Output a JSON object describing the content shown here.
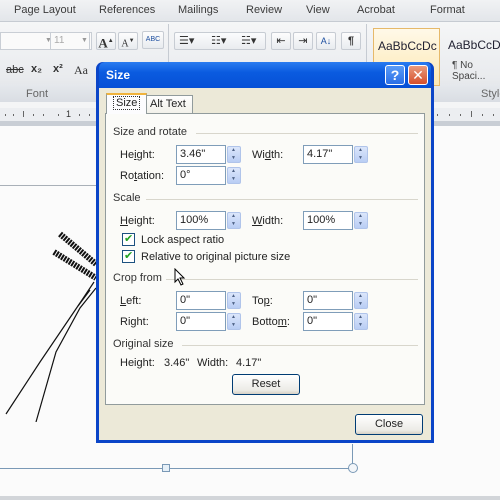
{
  "ribbon": {
    "tabs": [
      "Page Layout",
      "References",
      "Mailings",
      "Review",
      "View",
      "Acrobat",
      "Format"
    ],
    "font_size_value": "11",
    "group_labels": {
      "font": "Font",
      "styles": "Style"
    },
    "buttons": {
      "grow_font": "A",
      "shrink_font": "A",
      "clear_format": "ABC",
      "strikethrough": "abc",
      "subscript": "x₂",
      "superscript": "x²",
      "change_case": "Aa",
      "sort": "A↓",
      "show_marks": "¶"
    },
    "styles": [
      {
        "preview": "AaBbCcDc",
        "name": "",
        "selected": true
      },
      {
        "preview": "AaBbCcDc",
        "name": "¶ No Spaci...",
        "selected": false
      }
    ]
  },
  "ruler": {
    "label": "1"
  },
  "dialog": {
    "title": "Size",
    "help_glyph": "?",
    "close_glyph": "✕",
    "tabs": [
      {
        "label": "Size",
        "active": true
      },
      {
        "label": "Alt Text",
        "active": false
      }
    ],
    "size_and_rotate": {
      "heading": "Size and rotate",
      "height_label": "Height:",
      "height_value": "3.46\"",
      "width_label": "Width:",
      "width_value": "4.17\"",
      "rotation_label": "Rotation:",
      "rotation_value": "0°"
    },
    "scale": {
      "heading": "Scale",
      "height_label": "Height:",
      "height_value": "100%",
      "width_label": "Width:",
      "width_value": "100%",
      "lock_aspect_label": "Lock aspect ratio",
      "lock_aspect_checked": true,
      "relative_label": "Relative to original picture size",
      "relative_checked": true
    },
    "crop_from": {
      "heading": "Crop from",
      "left_label": "Left:",
      "left_value": "0\"",
      "top_label": "Top:",
      "top_value": "0\"",
      "right_label": "Right:",
      "right_value": "0\"",
      "bottom_label": "Bottom:",
      "bottom_value": "0\""
    },
    "original_size": {
      "heading": "Original size",
      "height_label": "Height:",
      "height_value": "3.46\"",
      "width_label": "Width:",
      "width_value": "4.17\"",
      "reset_label": "Reset"
    },
    "close_label": "Close"
  }
}
